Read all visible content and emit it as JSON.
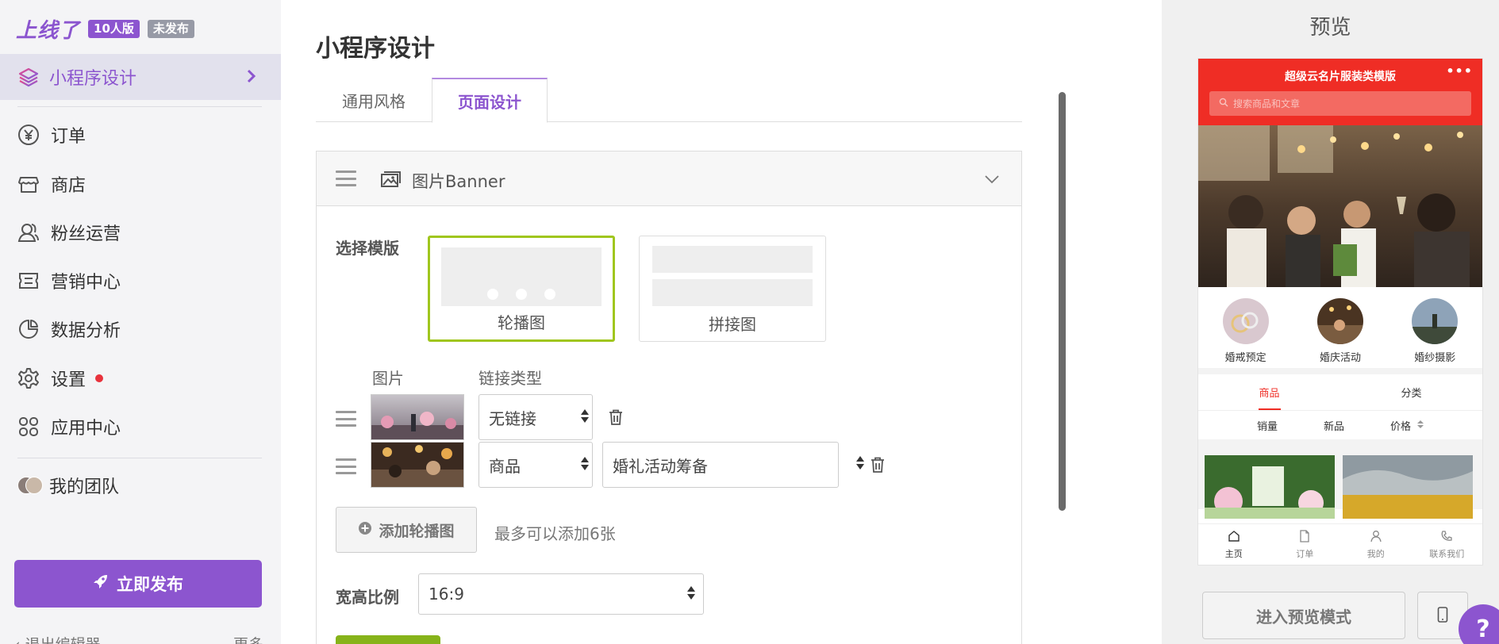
{
  "brand": {
    "logo": "上线了",
    "edition": "10人版",
    "status": "未发布"
  },
  "sidebar": {
    "active_item": "小程序设计",
    "items": [
      {
        "label": "订单",
        "icon": "yen-circle-icon"
      },
      {
        "label": "商店",
        "icon": "store-icon"
      },
      {
        "label": "粉丝运营",
        "icon": "users-icon"
      },
      {
        "label": "营销中心",
        "icon": "ticket-icon"
      },
      {
        "label": "数据分析",
        "icon": "pie-chart-icon"
      },
      {
        "label": "设置",
        "icon": "gear-icon"
      },
      {
        "label": "应用中心",
        "icon": "apps-icon"
      }
    ],
    "team": "我的团队",
    "publish": "立即发布",
    "exit_editor": "退出编辑器",
    "more": "更多"
  },
  "main": {
    "page_title": "小程序设计",
    "tabs": [
      "通用风格",
      "页面设计"
    ],
    "active_tab": "页面设计",
    "panel": {
      "title": "图片Banner",
      "template_label": "选择模版",
      "templates": [
        "轮播图",
        "拼接图"
      ],
      "selected_template": "轮播图",
      "col_image": "图片",
      "col_link_type": "链接类型",
      "rows": [
        {
          "link_type": "无链接",
          "link_target": ""
        },
        {
          "link_type": "商品",
          "link_target": "婚礼活动筹备"
        }
      ],
      "add_button": "添加轮播图",
      "add_hint": "最多可以添加6张",
      "ratio_label": "宽高比例",
      "ratio_value": "16:9"
    }
  },
  "preview": {
    "title": "预览",
    "phone": {
      "app_title": "超级云名片服装类模版",
      "more": "•••",
      "search_placeholder": "搜索商品和文章",
      "categories": [
        "婚戒预定",
        "婚庆活动",
        "婚纱摄影"
      ],
      "tabs": [
        "商品",
        "分类"
      ],
      "active_tab": "商品",
      "sort": [
        "销量",
        "新品",
        "价格"
      ],
      "footer": [
        "主页",
        "订单",
        "我的",
        "联系我们"
      ],
      "active_footer": "主页"
    },
    "preview_mode_button": "进入预览模式",
    "help": "?"
  },
  "colors": {
    "accent": "#8c55cf",
    "preview_red": "#ef2d25",
    "selected_border": "#a0c61e"
  }
}
